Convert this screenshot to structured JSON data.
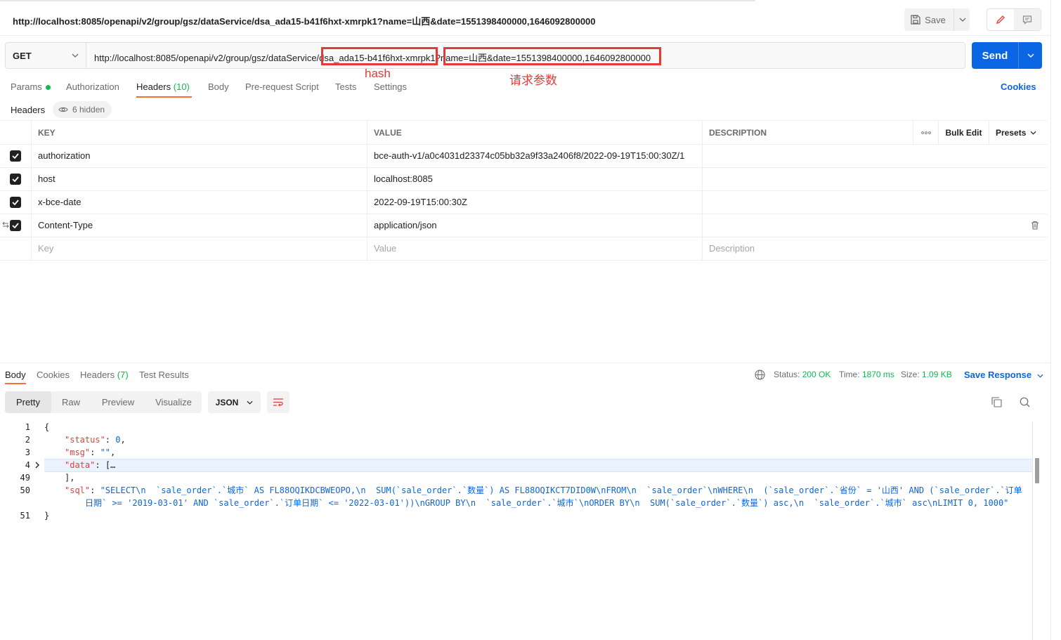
{
  "request": {
    "title": "http://localhost:8085/openapi/v2/group/gsz/dataService/dsa_ada15-b41f6hxt-xmrpk1?name=山西&date=1551398400000,1646092800000",
    "method": "GET",
    "url": "http://localhost:8085/openapi/v2/group/gsz/dataService/dsa_ada15-b41f6hxt-xmrpk1?name=山西&date=1551398400000,1646092800000",
    "save_label": "Save",
    "send_label": "Send"
  },
  "annotations": {
    "hash_label": "hash",
    "params_label": "请求参数",
    "color": "#e53935"
  },
  "request_tabs": {
    "params": "Params",
    "authorization": "Authorization",
    "headers": "Headers",
    "headers_count": "(10)",
    "body": "Body",
    "pre_request": "Pre-request Script",
    "tests": "Tests",
    "settings": "Settings",
    "cookies": "Cookies"
  },
  "headers_section": {
    "title": "Headers",
    "hidden": "6 hidden",
    "columns": {
      "key": "KEY",
      "value": "VALUE",
      "description": "DESCRIPTION",
      "bulk_edit": "Bulk Edit",
      "presets": "Presets"
    },
    "rows": [
      {
        "key": "authorization",
        "value": "bce-auth-v1/a0c4031d23374c05bb32a9f33a2406f8/2022-09-19T15:00:30Z/1"
      },
      {
        "key": "host",
        "value": "localhost:8085"
      },
      {
        "key": "x-bce-date",
        "value": "2022-09-19T15:00:30Z"
      },
      {
        "key": "Content-Type",
        "value": "application/json"
      }
    ],
    "placeholders": {
      "key": "Key",
      "value": "Value",
      "description": "Description"
    }
  },
  "response": {
    "tabs": {
      "body": "Body",
      "cookies": "Cookies",
      "headers": "Headers",
      "headers_count": "(7)",
      "test_results": "Test Results"
    },
    "status_label": "Status:",
    "status": "200 OK",
    "time_label": "Time:",
    "time": "1870 ms",
    "size_label": "Size:",
    "size": "1.09 KB",
    "save_response": "Save Response",
    "views": {
      "pretty": "Pretty",
      "raw": "Raw",
      "preview": "Preview",
      "visualize": "Visualize"
    },
    "format": "JSON",
    "code": {
      "line_numbers": [
        "1",
        "2",
        "3",
        "4",
        "49",
        "50",
        "",
        "51"
      ],
      "open_brace": "{",
      "status_key": "\"status\"",
      "status_val": "0",
      "msg_key": "\"msg\"",
      "msg_val": "\"\"",
      "data_key": "\"data\"",
      "data_collapsed": "[…",
      "close_bracket": "],",
      "sql_key": "\"sql\"",
      "sql_val_line1": "\"SELECT\\n  `sale_order`.`城市` AS FL88OQIKDCBWEOPO,\\n  SUM(`sale_order`.`数量`) AS FL88OQIKCT7DID0W\\nFROM\\n  `sale_order`\\nWHERE\\n  (`sale_order`.`省份` = '山西' AND (`sale_order`.`订单",
      "sql_val_line2": "日期` >= '2019-03-01' AND `sale_order`.`订单日期` <= '2022-03-01'))\\nGROUP BY\\n  `sale_order`.`城市`\\nORDER BY\\n  SUM(`sale_order`.`数量`) asc,\\n  `sale_order`.`城市` asc\\nLIMIT 0, 1000\"",
      "close_brace": "}"
    }
  },
  "colors": {
    "accent": "#ff6c37",
    "primary": "#0b66e4",
    "success": "#0cbb52",
    "json_key": "#e83c3c"
  }
}
